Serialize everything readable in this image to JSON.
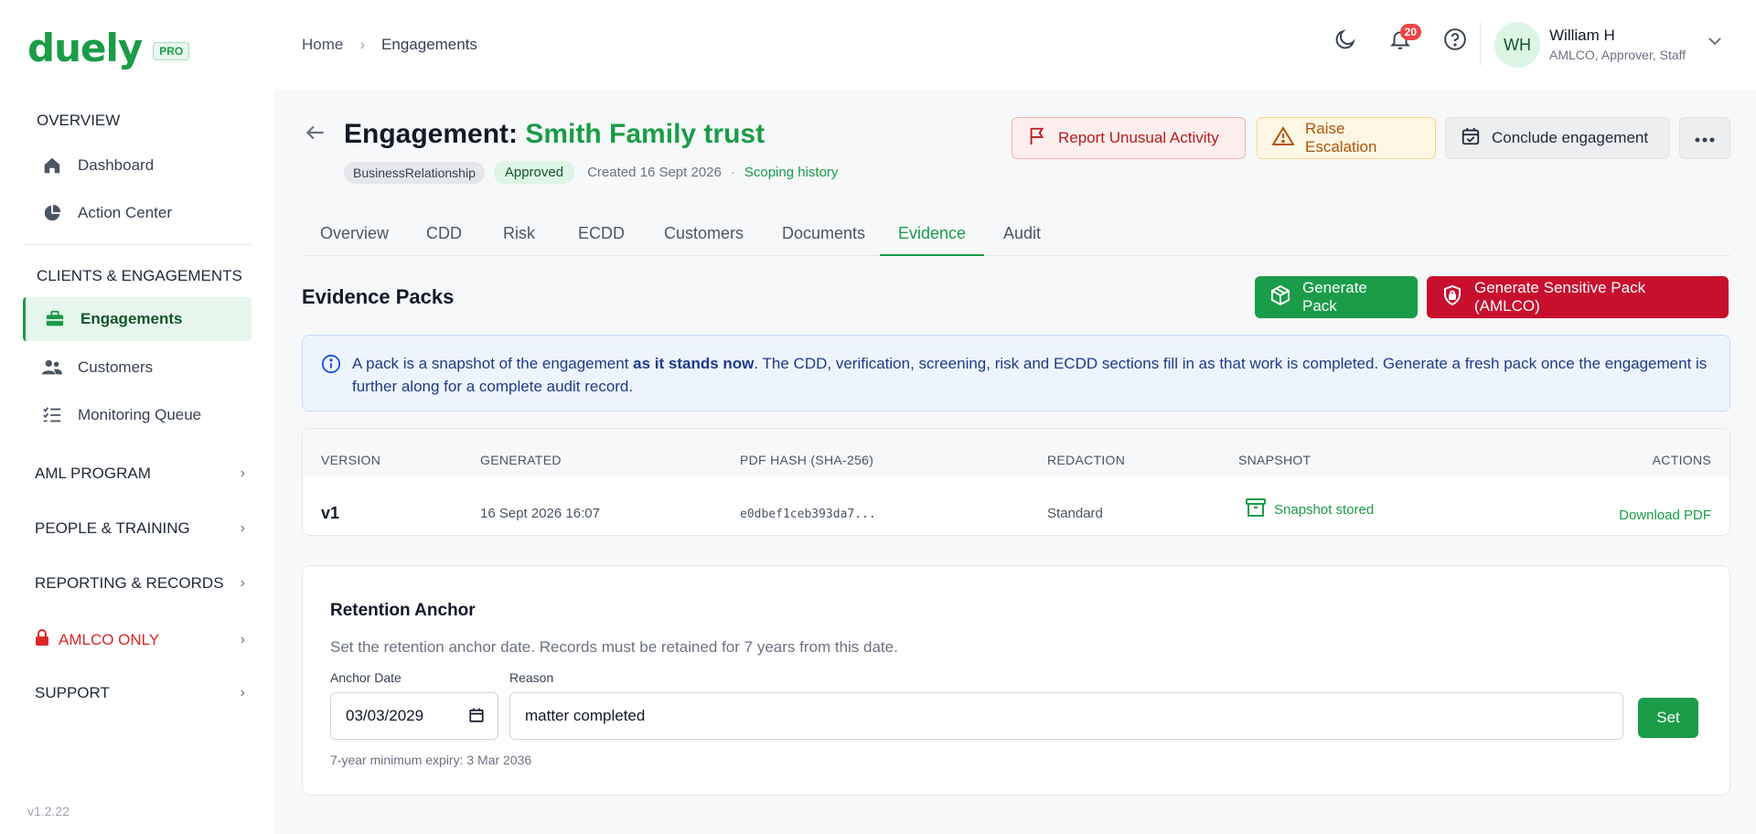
{
  "app": {
    "brand": "duely",
    "tier": "PRO",
    "version": "v1.2.22"
  },
  "sidebar": {
    "overview_heading": "OVERVIEW",
    "overview_items": [
      {
        "label": "Dashboard",
        "icon": "home-icon"
      },
      {
        "label": "Action Center",
        "icon": "pie-chart-icon"
      }
    ],
    "clients_heading": "CLIENTS & ENGAGEMENTS",
    "clients_items": [
      {
        "label": "Engagements",
        "icon": "briefcase-icon",
        "active": true
      },
      {
        "label": "Customers",
        "icon": "users-icon"
      },
      {
        "label": "Monitoring Queue",
        "icon": "list-check-icon"
      }
    ],
    "groups": [
      {
        "label": "AML PROGRAM"
      },
      {
        "label": "PEOPLE & TRAINING"
      },
      {
        "label": "REPORTING & RECORDS"
      },
      {
        "label": "AMLCO ONLY",
        "icon": "lock-icon"
      },
      {
        "label": "SUPPORT"
      }
    ]
  },
  "header": {
    "breadcrumb": [
      "Home",
      "Engagements"
    ],
    "notifications_count": "20",
    "user": {
      "initials": "WH",
      "name": "William H",
      "roles": "AMLCO, Approver, Staff"
    }
  },
  "engagement": {
    "title_prefix": "Engagement:",
    "title_name": "Smith Family trust",
    "type": "BusinessRelationship",
    "status": "Approved",
    "created": "Created 16 Sept 2026",
    "separator": "·",
    "scoping_link": "Scoping history"
  },
  "actions": {
    "report": "Report Unusual Activity",
    "raise": "Raise Escalation",
    "conclude": "Conclude engagement"
  },
  "tabs": [
    "Overview",
    "CDD",
    "Risk",
    "ECDD",
    "Customers",
    "Documents",
    "Evidence",
    "Audit"
  ],
  "active_tab": "Evidence",
  "evidence": {
    "title": "Evidence Packs",
    "generate_pack": "Generate Pack",
    "generate_sensitive": "Generate Sensitive Pack (AMLCO)",
    "info_before": "A pack is a snapshot of the engagement ",
    "info_bold": "as it stands now",
    "info_after": ". The CDD, verification, screening, risk and ECDD sections fill in as that work is completed. Generate a fresh pack once the engagement is further along for a complete audit record.",
    "columns": [
      "VERSION",
      "GENERATED",
      "PDF HASH (SHA-256)",
      "REDACTION",
      "SNAPSHOT",
      "ACTIONS"
    ],
    "rows": [
      {
        "version": "v1",
        "generated": "16 Sept 2026 16:07",
        "hash": "e0dbef1ceb393da7...",
        "redaction": "Standard",
        "snapshot": "Snapshot stored",
        "action": "Download PDF"
      }
    ]
  },
  "retention": {
    "title": "Retention Anchor",
    "description": "Set the retention anchor date. Records must be retained for 7 years from this date.",
    "anchor_label": "Anchor Date",
    "anchor_value": "03/03/2029",
    "reason_label": "Reason",
    "reason_value": "matter completed",
    "set_label": "Set",
    "hint": "7-year minimum expiry: 3 Mar 2036"
  },
  "colors": {
    "brand": "#1a9c48",
    "danger": "#c8102e",
    "warning": "#b45309",
    "info": "#1e3a8a"
  }
}
